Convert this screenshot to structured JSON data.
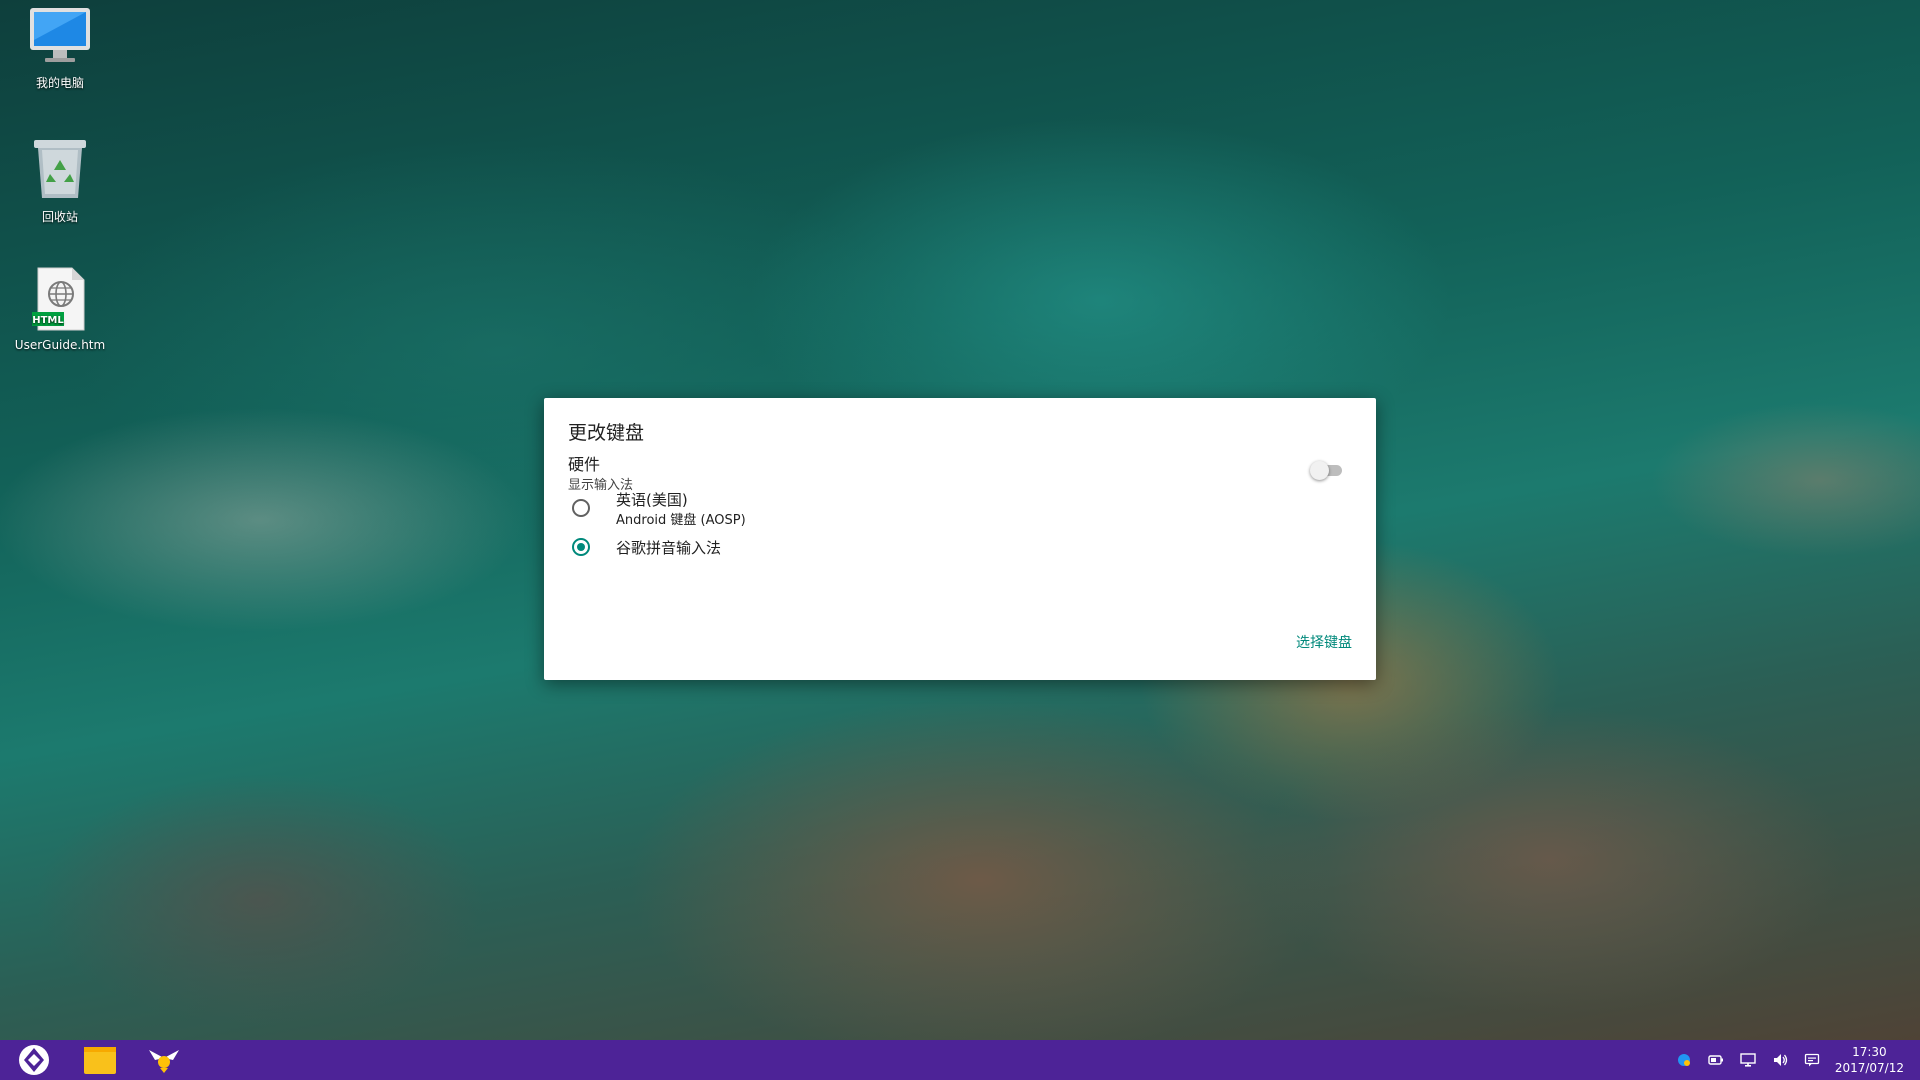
{
  "desktop": {
    "icons": [
      {
        "label": "我的电脑",
        "icon": "computer-icon"
      },
      {
        "label": "回收站",
        "icon": "recycle-bin-icon"
      },
      {
        "label": "UserGuide.htm",
        "icon": "html-file-icon",
        "badge": "HTML"
      }
    ]
  },
  "dialog": {
    "title": "更改键盘",
    "hardware_title": "硬件",
    "hardware_subtitle": "显示输入法",
    "toggle_on": false,
    "options": [
      {
        "title": "英语(美国)",
        "subtitle": "Android 键盘 (AOSP)",
        "selected": false
      },
      {
        "title": "谷歌拼音输入法",
        "subtitle": "",
        "selected": true
      }
    ],
    "choose_button": "选择键盘"
  },
  "taskbar": {
    "color": "#4d2397",
    "apps": [
      "start-icon",
      "file-manager-icon",
      "app-wings-icon"
    ],
    "tray": [
      "pinyin-ime-icon",
      "battery-icon",
      "display-icon",
      "volume-icon",
      "notification-icon"
    ],
    "time": "17:30",
    "date": "2017/07/12"
  },
  "colors": {
    "accent": "#00897b"
  }
}
